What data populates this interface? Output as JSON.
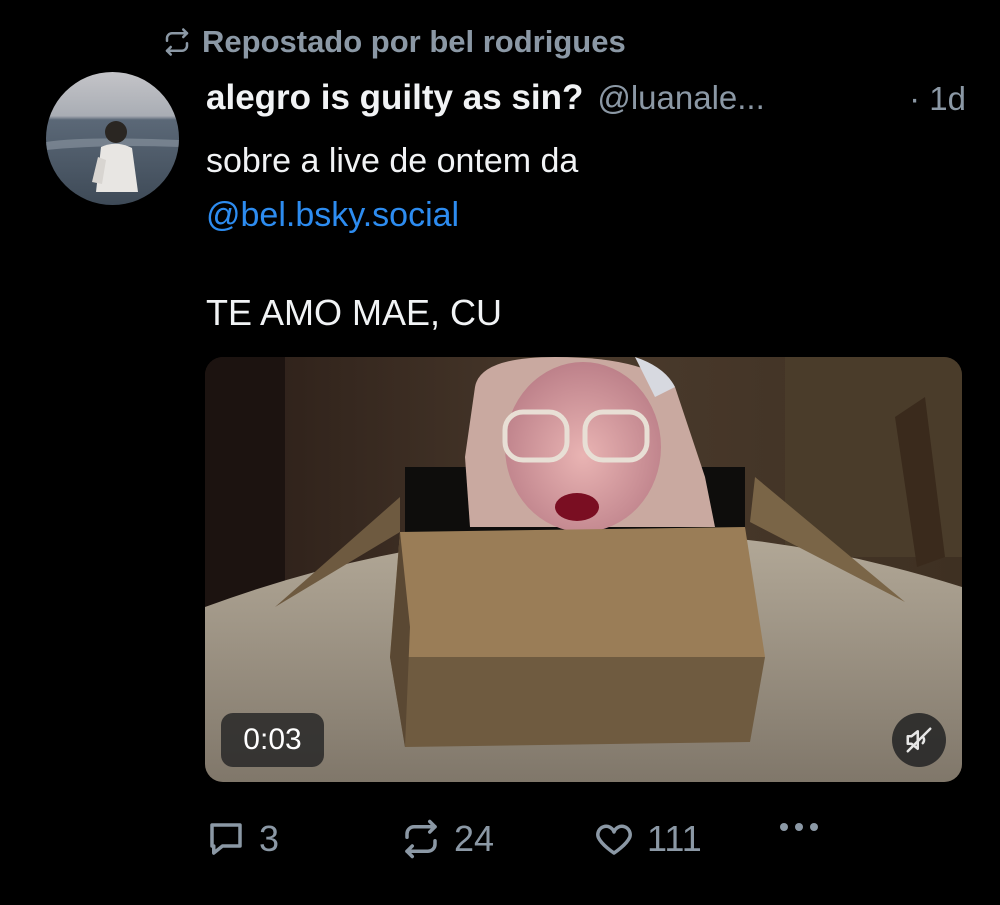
{
  "repost": {
    "label": "Repostado por bel rodrigues",
    "icon": "repost-icon"
  },
  "post": {
    "display_name": "alegro is guilty as sin?",
    "handle": "@luanale...",
    "time": "· 1d",
    "text_line1": "sobre a live de ontem da",
    "mention": "@bel.bsky.social",
    "text_line2": "TE AMO MAE, CU",
    "video": {
      "duration": "0:03",
      "muted": true
    }
  },
  "actions": {
    "replies": "3",
    "reposts": "24",
    "likes": "111"
  },
  "colors": {
    "background": "#000000",
    "text": "#f1f3f5",
    "secondary": "#8b98a5",
    "link": "#2d8cf0"
  }
}
